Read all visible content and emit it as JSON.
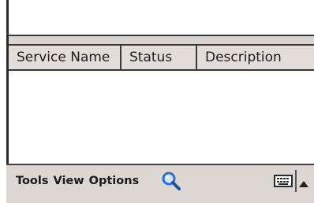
{
  "list": {
    "columns": [
      {
        "label": "Service Name"
      },
      {
        "label": "Status"
      },
      {
        "label": "Description"
      }
    ]
  },
  "menu": {
    "tools": "Tools",
    "view": "View",
    "options": "Options"
  },
  "icons": {
    "search": "search-icon",
    "keyboard": "keyboard-icon",
    "input_panel_arrow": "chevron-up-icon"
  },
  "colors": {
    "search_icon": "#2b6fd6",
    "header_bg": "#e3ddd9",
    "menu_bar_bg": "#dcd7d2"
  }
}
